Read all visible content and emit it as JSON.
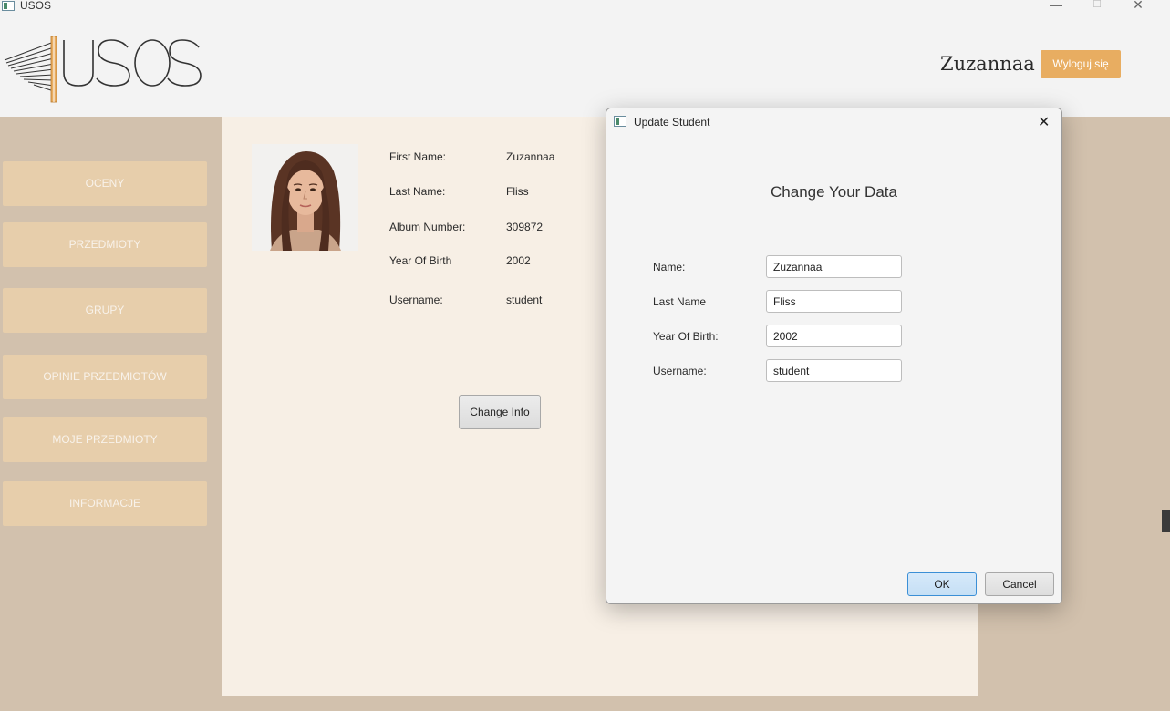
{
  "window": {
    "title": "USOS",
    "controls": {
      "minimize": "—",
      "maximize": "☐",
      "close": "✕"
    }
  },
  "header": {
    "logo_text": "USOS",
    "user_name": "Zuzannaa",
    "logout_label": "Wyloguj się"
  },
  "sidebar": {
    "items": [
      {
        "label": "OCENY"
      },
      {
        "label": "PRZEDMIOTY"
      },
      {
        "label": "GRUPY"
      },
      {
        "label": "OPINIE PRZEDMIOTÓW"
      },
      {
        "label": "MOJE PRZEDMIOTY"
      },
      {
        "label": "INFORMACJE"
      }
    ]
  },
  "profile": {
    "fields": [
      {
        "label": "First Name:",
        "value": "Zuzannaa"
      },
      {
        "label": "Last Name:",
        "value": "Fliss"
      },
      {
        "label": "Album Number:",
        "value": "309872"
      },
      {
        "label": "Year Of Birth",
        "value": "2002"
      },
      {
        "label": "Username:",
        "value": "student"
      }
    ],
    "change_info_label": "Change Info"
  },
  "dialog": {
    "title": "Update Student",
    "close_glyph": "✕",
    "heading": "Change Your Data",
    "fields": [
      {
        "label": "Name:",
        "value": "Zuzannaa"
      },
      {
        "label": "Last Name",
        "value": "Fliss"
      },
      {
        "label": "Year Of Birth:",
        "value": "2002"
      },
      {
        "label": "Username:",
        "value": "student"
      }
    ],
    "ok_label": "OK",
    "cancel_label": "Cancel"
  },
  "colors": {
    "sidebar_bg": "#d2c1ad",
    "sidebar_button": "#e7ceab",
    "main_bg": "#f7efe5",
    "accent": "#e8ad61",
    "ok_border": "#3b8fd6"
  }
}
